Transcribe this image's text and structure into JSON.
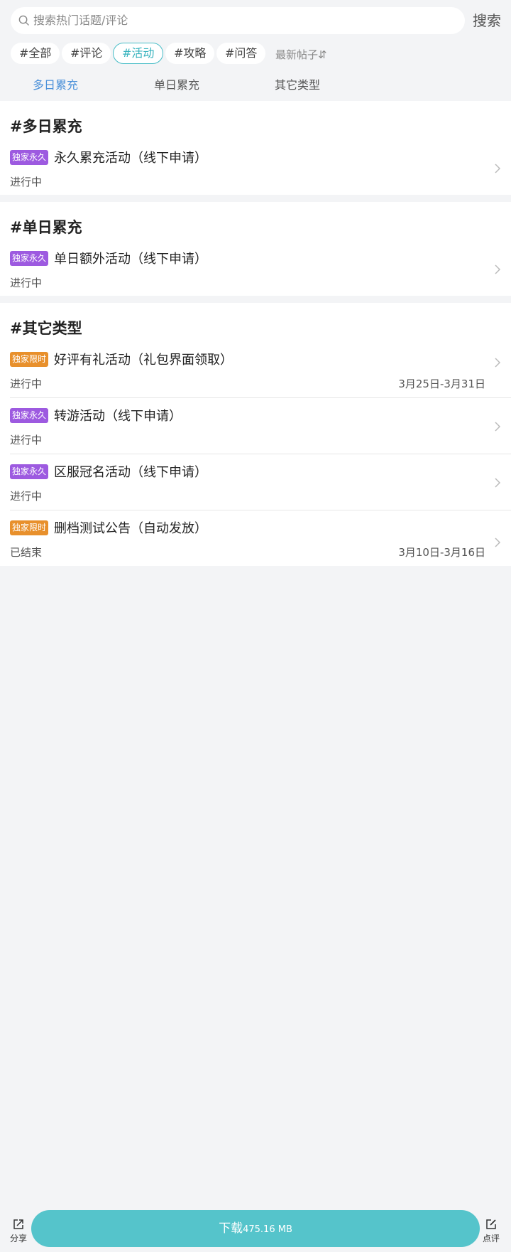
{
  "search": {
    "placeholder": "搜索热门话题/评论",
    "button_label": "搜索"
  },
  "filters": [
    {
      "label": "#全部",
      "active": false
    },
    {
      "label": "#评论",
      "active": false
    },
    {
      "label": "#活动",
      "active": true
    },
    {
      "label": "#攻略",
      "active": false
    },
    {
      "label": "#问答",
      "active": false
    }
  ],
  "sort_label": "最新帖子⇵",
  "tabs": [
    {
      "label": "多日累充",
      "active": true
    },
    {
      "label": "单日累充",
      "active": false
    },
    {
      "label": "其它类型",
      "active": false
    }
  ],
  "sections": [
    {
      "title": "#多日累充",
      "items": [
        {
          "badge": "独家永久",
          "badge_type": "permanent",
          "title": "永久累充活动（线下申请）",
          "status": "进行中",
          "date": ""
        }
      ]
    },
    {
      "title": "#单日累充",
      "items": [
        {
          "badge": "独家永久",
          "badge_type": "permanent",
          "title": "单日额外活动（线下申请）",
          "status": "进行中",
          "date": ""
        }
      ]
    },
    {
      "title": "#其它类型",
      "items": [
        {
          "badge": "独家限时",
          "badge_type": "limited",
          "title": "好评有礼活动（礼包界面领取）",
          "status": "进行中",
          "date": "3月25日-3月31日"
        },
        {
          "badge": "独家永久",
          "badge_type": "permanent",
          "title": "转游活动（线下申请）",
          "status": "进行中",
          "date": ""
        },
        {
          "badge": "独家永久",
          "badge_type": "permanent",
          "title": "区服冠名活动（线下申请）",
          "status": "进行中",
          "date": ""
        },
        {
          "badge": "独家限时",
          "badge_type": "limited",
          "title": "删档测试公告（自动发放）",
          "status": "已结束",
          "date": "3月10日-3月16日"
        }
      ]
    }
  ],
  "bottom": {
    "share_label": "分享",
    "download_label": "下载",
    "download_size": "475.16 MB",
    "review_label": "点评"
  },
  "colors": {
    "accent": "#55c4cb",
    "tab_active": "#4a90d9",
    "badge_permanent": "#9d5ae0",
    "badge_limited": "#e8902c",
    "background": "#f3f4f6"
  }
}
